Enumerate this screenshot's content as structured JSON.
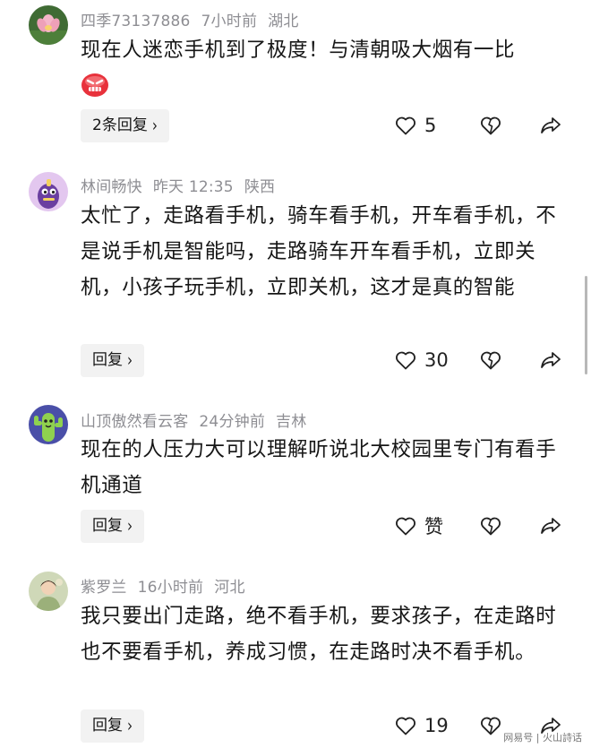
{
  "comments": [
    {
      "username": "四季73137886",
      "time": "7小时前",
      "location": "湖北",
      "text": "现在人迷恋手机到了极度！与清朝吸大烟有一比",
      "reply_label": "2条回复",
      "like_count": "5",
      "emoji": "angry-face-emoji"
    },
    {
      "username": "林间畅快",
      "time": "昨天 12:35",
      "location": "陕西",
      "text": "太忙了，走路看手机，骑车看手机，开车看手机，不是说手机是智能吗，走路骑车开车看手机，立即关机，小孩子玩手机，立即关机，这才是真的智能",
      "reply_label": "回复",
      "like_count": "30"
    },
    {
      "username": "山顶傲然看云客",
      "time": "24分钟前",
      "location": "吉林",
      "text": "现在的人压力大可以理解听说北大校园里专门有看手机通道",
      "reply_label": "回复",
      "like_count": "赞"
    },
    {
      "username": "紫罗兰",
      "time": "16小时前",
      "location": "河北",
      "text": "我只要出门走路，绝不看手机，要求孩子，在走路时也不要看手机，养成习惯，在走路时决不看手机。",
      "reply_label": "回复",
      "like_count": "19"
    }
  ],
  "icons": {
    "like": "heart-outline-icon",
    "dislike": "broken-heart-icon",
    "share": "share-arrow-icon"
  },
  "watermark": "网易号 | 火山詩话"
}
